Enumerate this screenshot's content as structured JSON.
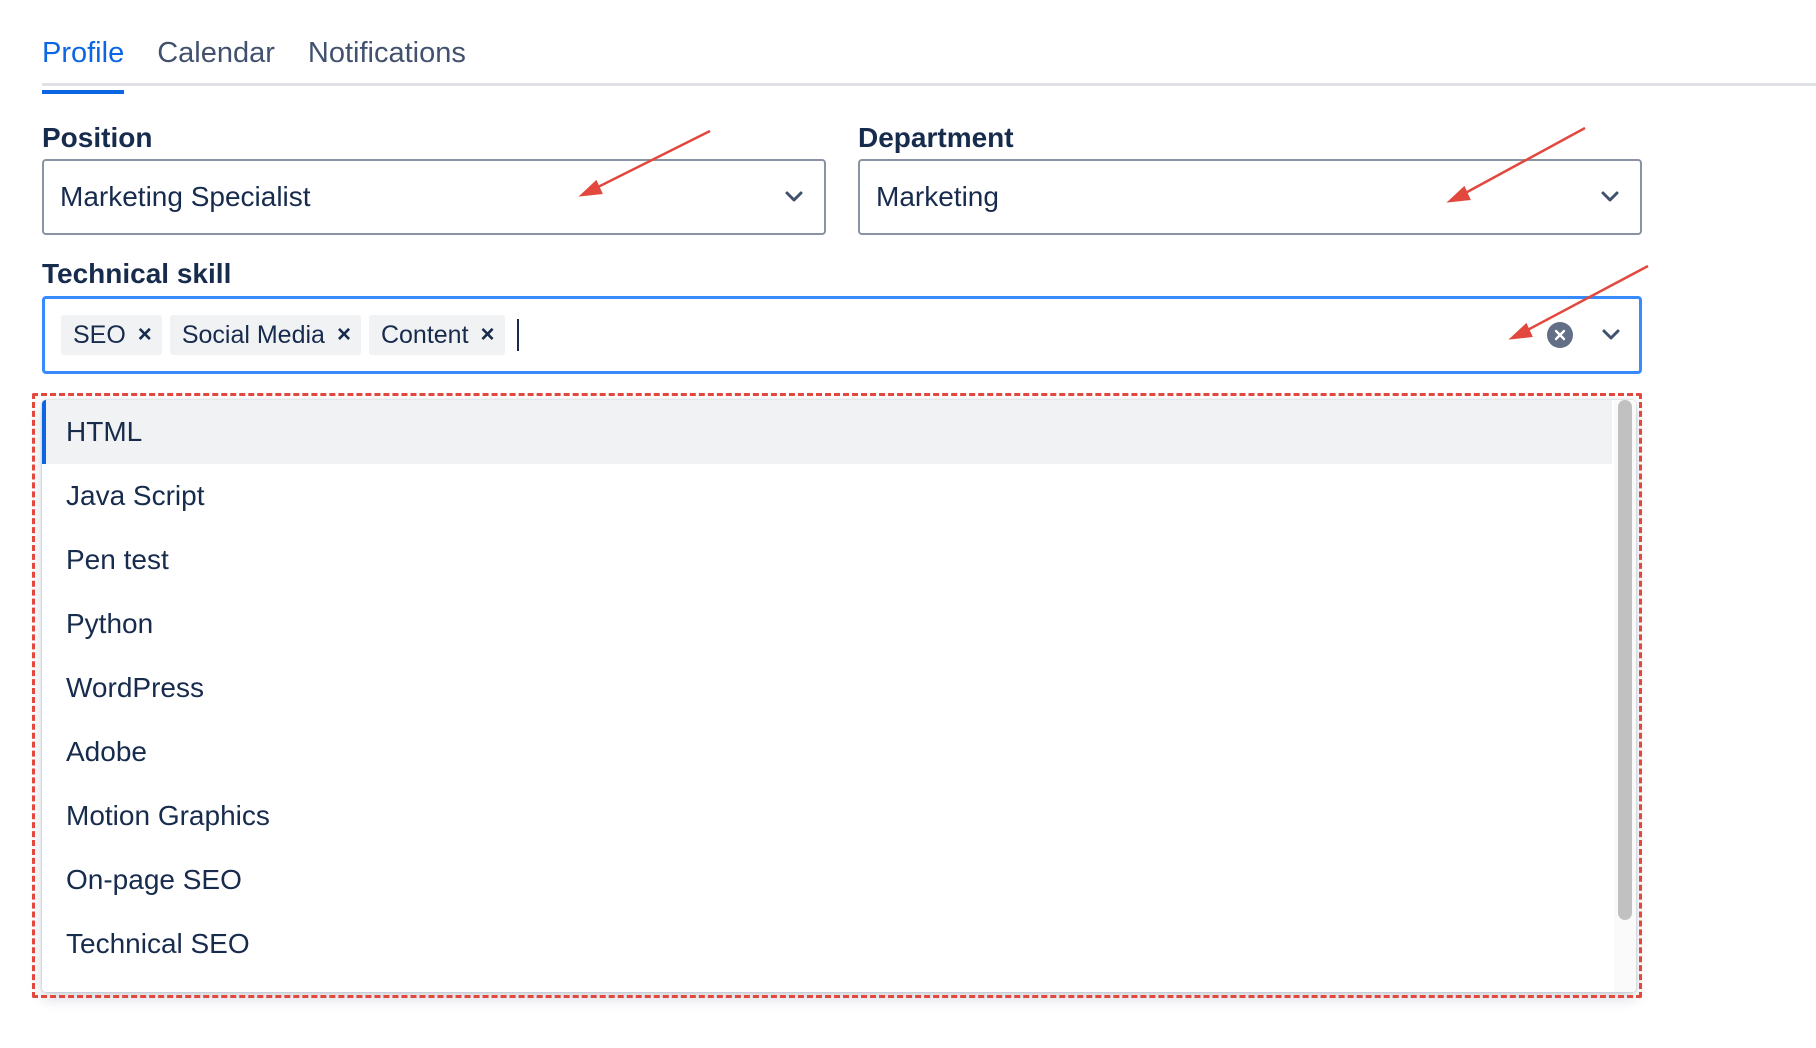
{
  "tabs": [
    {
      "label": "Profile",
      "active": true
    },
    {
      "label": "Calendar",
      "active": false
    },
    {
      "label": "Notifications",
      "active": false
    }
  ],
  "position": {
    "label": "Position",
    "value": "Marketing Specialist"
  },
  "department": {
    "label": "Department",
    "value": "Marketing"
  },
  "technical_skill": {
    "label": "Technical skill",
    "chips": [
      "SEO",
      "Social Media",
      "Content"
    ],
    "chip_remove_glyph": "×"
  },
  "options": [
    "HTML",
    "Java Script",
    "Pen test",
    "Python",
    "WordPress",
    "Adobe",
    "Motion Graphics",
    "On-page SEO",
    "Technical SEO"
  ],
  "colors": {
    "accent": "#0c66e4",
    "focus_border": "#388bff",
    "annotation": "#e2483d"
  }
}
